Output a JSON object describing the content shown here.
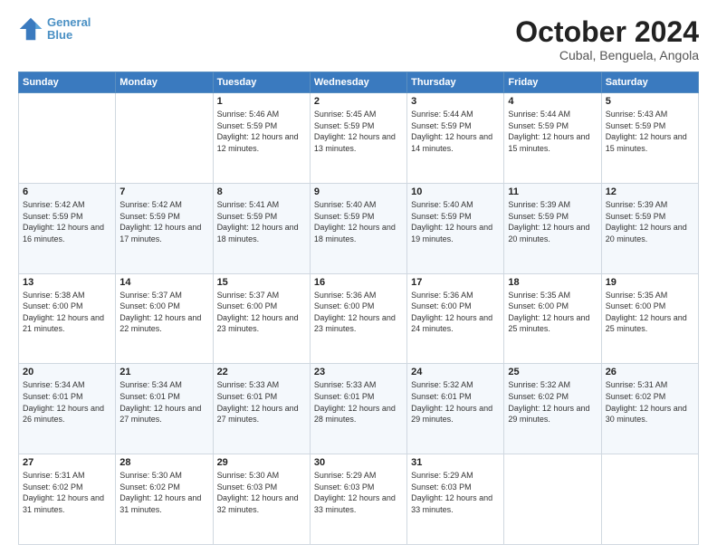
{
  "logo": {
    "line1": "General",
    "line2": "Blue"
  },
  "title": "October 2024",
  "subtitle": "Cubal, Benguela, Angola",
  "days_of_week": [
    "Sunday",
    "Monday",
    "Tuesday",
    "Wednesday",
    "Thursday",
    "Friday",
    "Saturday"
  ],
  "weeks": [
    [
      {
        "day": "",
        "info": ""
      },
      {
        "day": "",
        "info": ""
      },
      {
        "day": "1",
        "info": "Sunrise: 5:46 AM\nSunset: 5:59 PM\nDaylight: 12 hours and 12 minutes."
      },
      {
        "day": "2",
        "info": "Sunrise: 5:45 AM\nSunset: 5:59 PM\nDaylight: 12 hours and 13 minutes."
      },
      {
        "day": "3",
        "info": "Sunrise: 5:44 AM\nSunset: 5:59 PM\nDaylight: 12 hours and 14 minutes."
      },
      {
        "day": "4",
        "info": "Sunrise: 5:44 AM\nSunset: 5:59 PM\nDaylight: 12 hours and 15 minutes."
      },
      {
        "day": "5",
        "info": "Sunrise: 5:43 AM\nSunset: 5:59 PM\nDaylight: 12 hours and 15 minutes."
      }
    ],
    [
      {
        "day": "6",
        "info": "Sunrise: 5:42 AM\nSunset: 5:59 PM\nDaylight: 12 hours and 16 minutes."
      },
      {
        "day": "7",
        "info": "Sunrise: 5:42 AM\nSunset: 5:59 PM\nDaylight: 12 hours and 17 minutes."
      },
      {
        "day": "8",
        "info": "Sunrise: 5:41 AM\nSunset: 5:59 PM\nDaylight: 12 hours and 18 minutes."
      },
      {
        "day": "9",
        "info": "Sunrise: 5:40 AM\nSunset: 5:59 PM\nDaylight: 12 hours and 18 minutes."
      },
      {
        "day": "10",
        "info": "Sunrise: 5:40 AM\nSunset: 5:59 PM\nDaylight: 12 hours and 19 minutes."
      },
      {
        "day": "11",
        "info": "Sunrise: 5:39 AM\nSunset: 5:59 PM\nDaylight: 12 hours and 20 minutes."
      },
      {
        "day": "12",
        "info": "Sunrise: 5:39 AM\nSunset: 5:59 PM\nDaylight: 12 hours and 20 minutes."
      }
    ],
    [
      {
        "day": "13",
        "info": "Sunrise: 5:38 AM\nSunset: 6:00 PM\nDaylight: 12 hours and 21 minutes."
      },
      {
        "day": "14",
        "info": "Sunrise: 5:37 AM\nSunset: 6:00 PM\nDaylight: 12 hours and 22 minutes."
      },
      {
        "day": "15",
        "info": "Sunrise: 5:37 AM\nSunset: 6:00 PM\nDaylight: 12 hours and 23 minutes."
      },
      {
        "day": "16",
        "info": "Sunrise: 5:36 AM\nSunset: 6:00 PM\nDaylight: 12 hours and 23 minutes."
      },
      {
        "day": "17",
        "info": "Sunrise: 5:36 AM\nSunset: 6:00 PM\nDaylight: 12 hours and 24 minutes."
      },
      {
        "day": "18",
        "info": "Sunrise: 5:35 AM\nSunset: 6:00 PM\nDaylight: 12 hours and 25 minutes."
      },
      {
        "day": "19",
        "info": "Sunrise: 5:35 AM\nSunset: 6:00 PM\nDaylight: 12 hours and 25 minutes."
      }
    ],
    [
      {
        "day": "20",
        "info": "Sunrise: 5:34 AM\nSunset: 6:01 PM\nDaylight: 12 hours and 26 minutes."
      },
      {
        "day": "21",
        "info": "Sunrise: 5:34 AM\nSunset: 6:01 PM\nDaylight: 12 hours and 27 minutes."
      },
      {
        "day": "22",
        "info": "Sunrise: 5:33 AM\nSunset: 6:01 PM\nDaylight: 12 hours and 27 minutes."
      },
      {
        "day": "23",
        "info": "Sunrise: 5:33 AM\nSunset: 6:01 PM\nDaylight: 12 hours and 28 minutes."
      },
      {
        "day": "24",
        "info": "Sunrise: 5:32 AM\nSunset: 6:01 PM\nDaylight: 12 hours and 29 minutes."
      },
      {
        "day": "25",
        "info": "Sunrise: 5:32 AM\nSunset: 6:02 PM\nDaylight: 12 hours and 29 minutes."
      },
      {
        "day": "26",
        "info": "Sunrise: 5:31 AM\nSunset: 6:02 PM\nDaylight: 12 hours and 30 minutes."
      }
    ],
    [
      {
        "day": "27",
        "info": "Sunrise: 5:31 AM\nSunset: 6:02 PM\nDaylight: 12 hours and 31 minutes."
      },
      {
        "day": "28",
        "info": "Sunrise: 5:30 AM\nSunset: 6:02 PM\nDaylight: 12 hours and 31 minutes."
      },
      {
        "day": "29",
        "info": "Sunrise: 5:30 AM\nSunset: 6:03 PM\nDaylight: 12 hours and 32 minutes."
      },
      {
        "day": "30",
        "info": "Sunrise: 5:29 AM\nSunset: 6:03 PM\nDaylight: 12 hours and 33 minutes."
      },
      {
        "day": "31",
        "info": "Sunrise: 5:29 AM\nSunset: 6:03 PM\nDaylight: 12 hours and 33 minutes."
      },
      {
        "day": "",
        "info": ""
      },
      {
        "day": "",
        "info": ""
      }
    ]
  ]
}
